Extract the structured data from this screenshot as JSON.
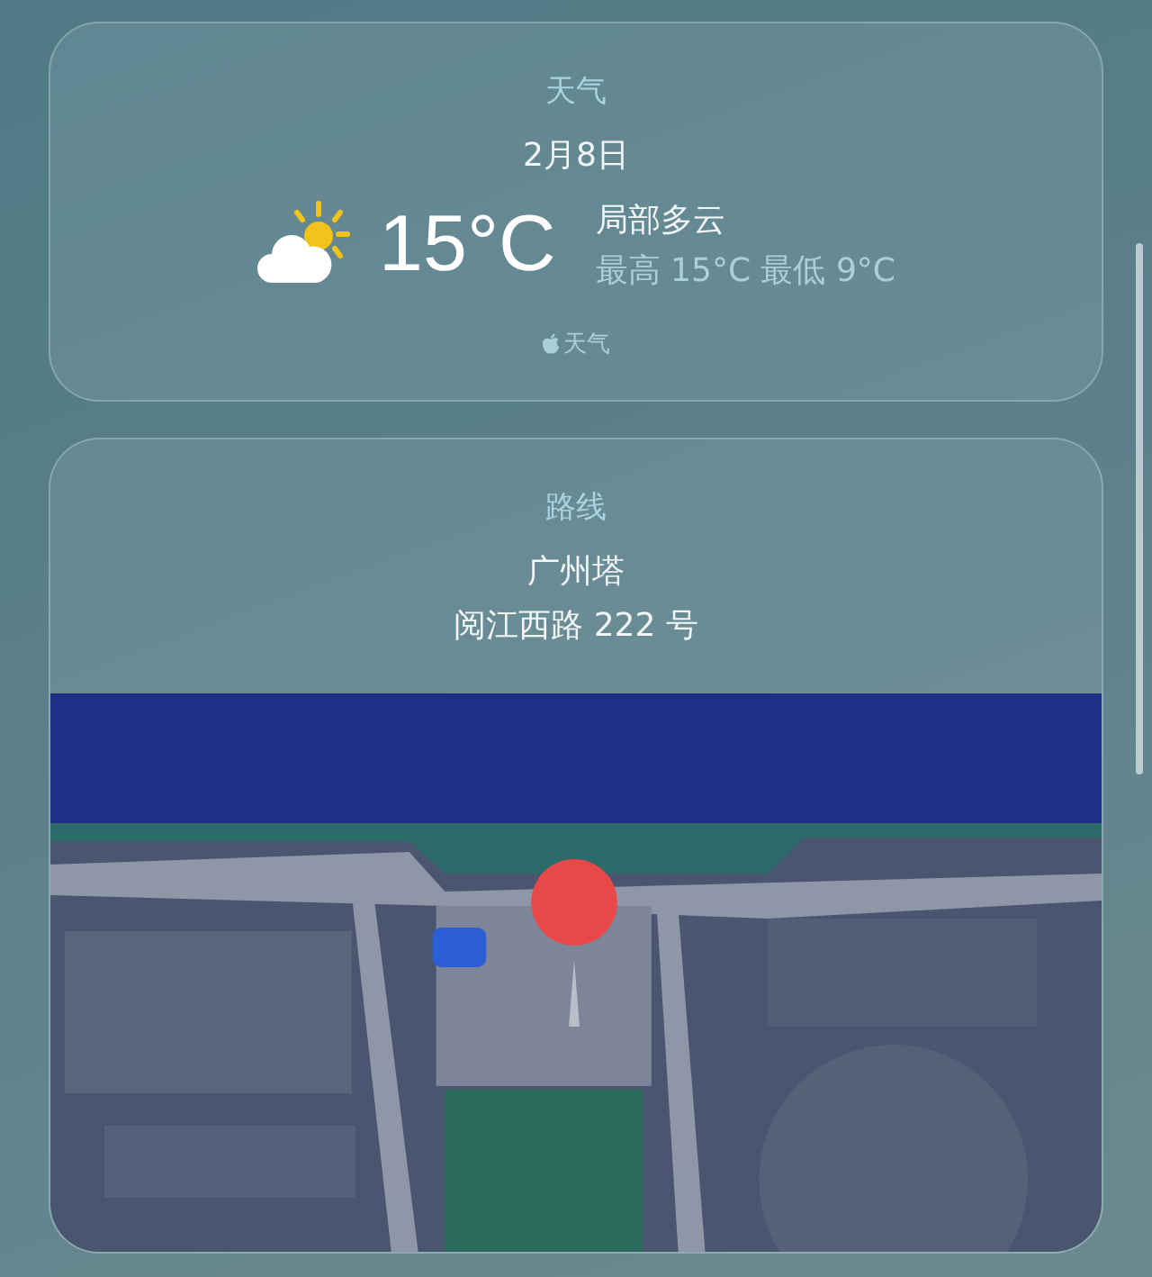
{
  "weather_card": {
    "title": "天气",
    "date": "2月8日",
    "temperature": "15°C",
    "condition": "局部多云",
    "range": "最高 15°C 最低 9°C",
    "source": "天气"
  },
  "route_card": {
    "title": "路线",
    "place": "广州塔",
    "address": "阅江西路 222 号"
  }
}
